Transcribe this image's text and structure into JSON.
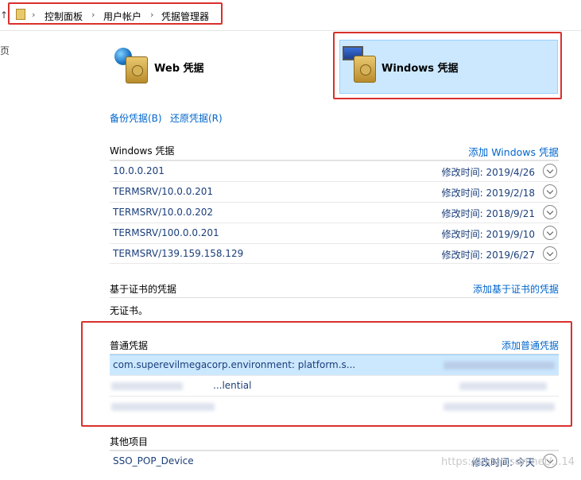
{
  "breadcrumb": {
    "up_arrow": "↑",
    "items": [
      "控制面板",
      "用户帐户",
      "凭据管理器"
    ],
    "separator": "›"
  },
  "left_fragment": "页",
  "tiles": {
    "web_label": "Web 凭据",
    "windows_label": "Windows 凭据"
  },
  "actions": {
    "backup": "备份凭据(B)",
    "restore": "还原凭据(R)"
  },
  "windows_creds": {
    "title": "Windows 凭据",
    "add_link": "添加 Windows 凭据",
    "rows": [
      {
        "name": "10.0.0.201",
        "modified": "修改时间:  2019/4/26"
      },
      {
        "name": "TERMSRV/10.0.0.201",
        "modified": "修改时间:  2019/2/18"
      },
      {
        "name": "TERMSRV/10.0.0.202",
        "modified": "修改时间:  2018/9/21"
      },
      {
        "name": "TERMSRV/100.0.0.201",
        "modified": "修改时间:  2019/9/10"
      },
      {
        "name": "TERMSRV/139.159.158.129",
        "modified": "修改时间:  2019/6/27"
      }
    ]
  },
  "cert_creds": {
    "title": "基于证书的凭据",
    "add_link": "添加基于证书的凭据",
    "empty_text": "无证书。"
  },
  "generic_creds": {
    "title": "普通凭据",
    "add_link": "添加普通凭据",
    "rows": [
      {
        "name": "com.superevilmegacorp.environment: platform.s..."
      },
      {
        "name": "...lential"
      }
    ]
  },
  "other_items": {
    "title": "其他项目",
    "rows": [
      {
        "name": "SSO_POP_Device",
        "modified": "修改时间:  今天"
      }
    ]
  },
  "watermark": "https://blog.csdn.net/...14"
}
